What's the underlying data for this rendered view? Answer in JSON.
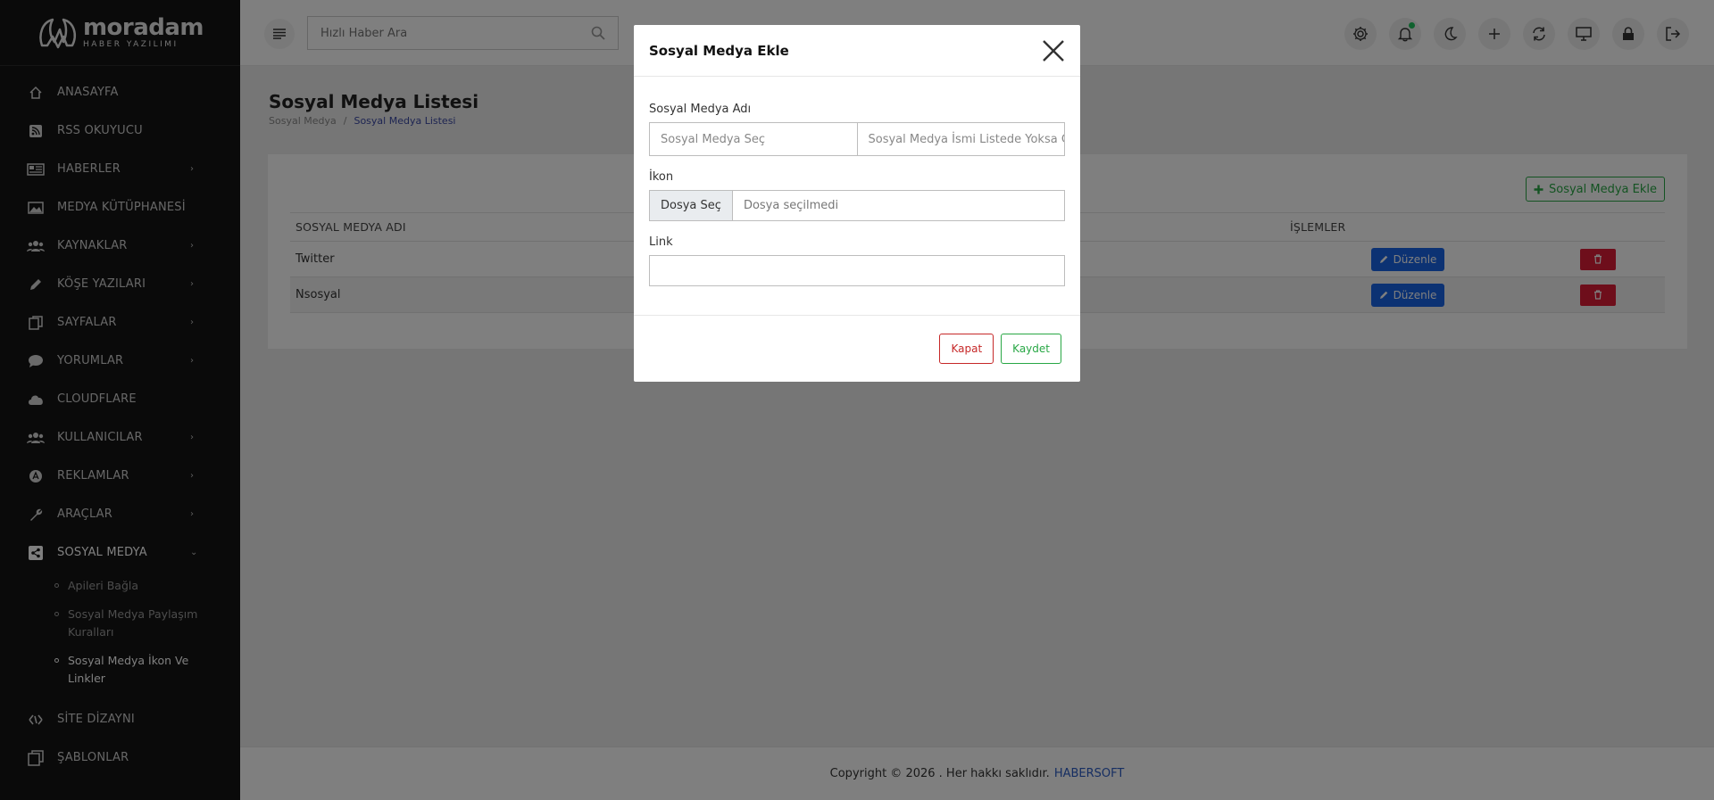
{
  "sidebar": {
    "logo": {
      "name": "moradam",
      "subtitle": "HABER YAZILIMI"
    },
    "items": [
      {
        "label": "ANASAYFA",
        "icon": "home-icon",
        "chevron": ""
      },
      {
        "label": "RSS OKUYUCU",
        "icon": "rss-icon",
        "chevron": ""
      },
      {
        "label": "HABERLER",
        "icon": "newspaper-icon",
        "chevron": "›"
      },
      {
        "label": "MEDYA KÜTÜPHANESİ",
        "icon": "image-icon",
        "chevron": ""
      },
      {
        "label": "KAYNAKLAR",
        "icon": "users-icon",
        "chevron": "›"
      },
      {
        "label": "KÖŞE YAZILARI",
        "icon": "pencil-icon",
        "chevron": "›"
      },
      {
        "label": "SAYFALAR",
        "icon": "pages-icon",
        "chevron": "›"
      },
      {
        "label": "YORUMLAR",
        "icon": "comment-icon",
        "chevron": "›"
      },
      {
        "label": "CLOUDFLARE",
        "icon": "cloud-icon",
        "chevron": ""
      },
      {
        "label": "KULLANICILAR",
        "icon": "users-icon",
        "chevron": "›"
      },
      {
        "label": "REKLAMLAR",
        "icon": "ad-icon",
        "chevron": "›"
      },
      {
        "label": "ARAÇLAR",
        "icon": "wrench-icon",
        "chevron": "›"
      },
      {
        "label": "SOSYAL MEDYA",
        "icon": "share-icon",
        "chevron": "⌄"
      }
    ],
    "sub_items": [
      {
        "label": "Apileri Bağla"
      },
      {
        "label": "Sosyal Medya Paylaşım Kuralları"
      },
      {
        "label": "Sosyal Medya İkon Ve Linkler"
      }
    ],
    "bottom_items": [
      {
        "label": "SİTE DİZAYNI",
        "icon": "design-icon"
      },
      {
        "label": "ŞABLONLAR",
        "icon": "templates-icon"
      }
    ]
  },
  "topbar": {
    "search_placeholder": "Hızlı Haber Ara"
  },
  "page": {
    "title": "Sosyal Medya Listesi",
    "breadcrumb": [
      "Sosyal Medya",
      "/",
      "Sosyal Medya Listesi"
    ],
    "add_button": "Sosyal Medya Ekle"
  },
  "table": {
    "headers": [
      "SOSYAL MEDYA ADI",
      "",
      "İŞLEMLER",
      ""
    ],
    "rows": [
      {
        "name": "Twitter",
        "edit": "Düzenle"
      },
      {
        "name": "Nsosyal",
        "edit": "Düzenle"
      }
    ]
  },
  "footer": {
    "text": "Copyright © 2026 . Her hakkı saklıdır.",
    "brand": "HABERSOFT"
  },
  "modal": {
    "title": "Sosyal Medya Ekle",
    "name_label": "Sosyal Medya Adı",
    "name_select_placeholder": "Sosyal Medya Seç",
    "name_text_placeholder": "Sosyal Medya İsmi Listede Yoksa G",
    "icon_label": "İkon",
    "file_button": "Dosya Seç",
    "file_status": "Dosya seçilmedi",
    "link_label": "Link",
    "link_value": "",
    "close_button": "Kapat",
    "save_button": "Kaydet"
  },
  "colors": {
    "sidebar_bg": "#141414",
    "accent_green": "#28a745",
    "edit_blue": "#1864e6",
    "delete_red": "#dc1c36",
    "brand_link": "#2c5cc5"
  }
}
